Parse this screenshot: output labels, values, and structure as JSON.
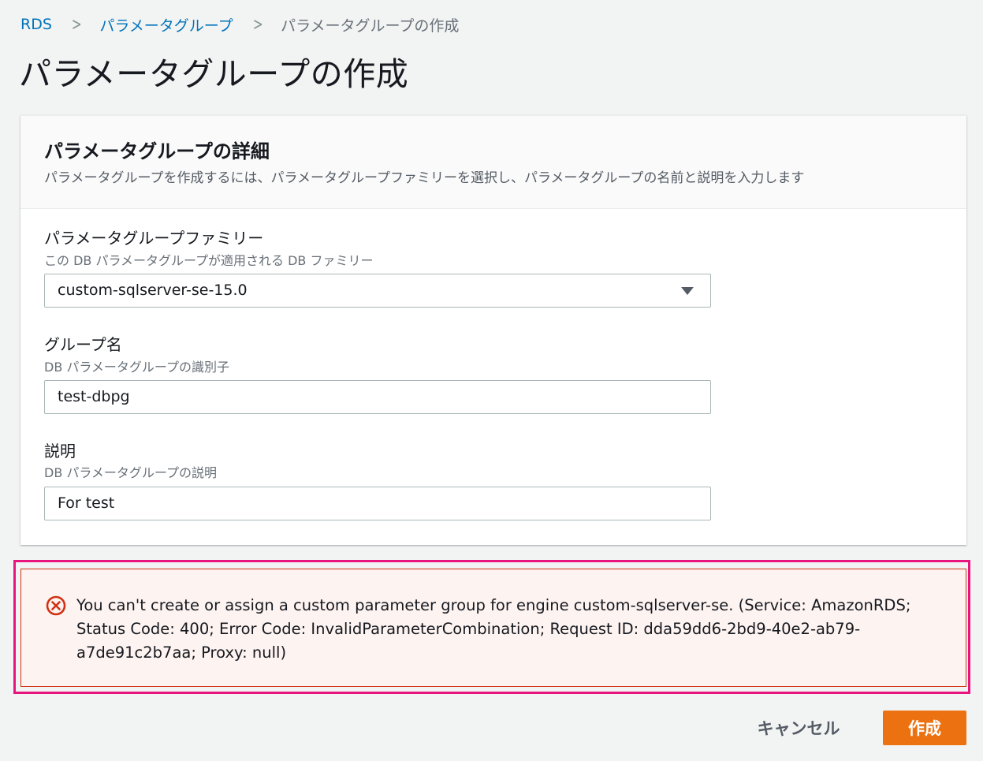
{
  "breadcrumb": {
    "items": [
      "RDS",
      "パラメータグループ"
    ],
    "current": "パラメータグループの作成"
  },
  "page": {
    "title": "パラメータグループの作成"
  },
  "panel": {
    "title": "パラメータグループの詳細",
    "description": "パラメータグループを作成するには、パラメータグループファミリーを選択し、パラメータグループの名前と説明を入力します",
    "fields": {
      "family": {
        "label": "パラメータグループファミリー",
        "description": "この DB パラメータグループが適用される DB ファミリー",
        "value": "custom-sqlserver-se-15.0"
      },
      "name": {
        "label": "グループ名",
        "description": "DB パラメータグループの識別子",
        "value": "test-dbpg"
      },
      "description": {
        "label": "説明",
        "description": "DB パラメータグループの説明",
        "value": "For test"
      }
    }
  },
  "error": {
    "icon": "error-circle-icon",
    "color": "#d13212",
    "message": "You can't create or assign a custom parameter group for engine custom-sqlserver-se. (Service: AmazonRDS; Status Code: 400; Error Code: InvalidParameterCombination; Request ID: dda59dd6-2bd9-40e2-ab79-a7de91c2b7aa; Proxy: null)"
  },
  "actions": {
    "cancel_label": "キャンセル",
    "create_label": "作成",
    "create_color": "#ec7211"
  }
}
